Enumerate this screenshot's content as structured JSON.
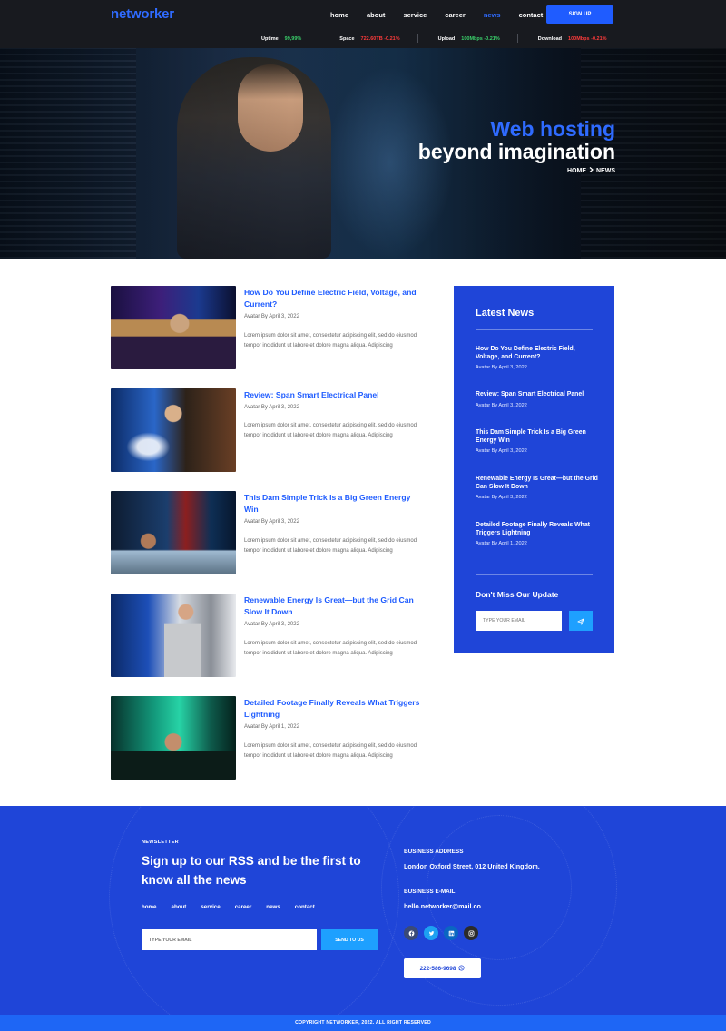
{
  "brand": {
    "logo": "networker"
  },
  "nav": {
    "items": [
      "home",
      "about",
      "service",
      "career",
      "news",
      "contact"
    ],
    "active": "news",
    "signup_label": "SIGN UP"
  },
  "stats": [
    {
      "label": "Uptime",
      "value": "99,99%",
      "trend": "up"
    },
    {
      "label": "Space",
      "value": "722.60TB -0.21%",
      "trend": "down"
    },
    {
      "label": "Upload",
      "value": "100Mbps -0.21%",
      "trend": "up"
    },
    {
      "label": "Download",
      "value": "100Mbps -0.21%",
      "trend": "down"
    }
  ],
  "hero": {
    "title_line1": "Web hosting",
    "title_line2": "beyond imagination",
    "breadcrumb_home": "HOME",
    "breadcrumb_current": "NEWS"
  },
  "posts": [
    {
      "title": "How Do You Define Electric Field, Voltage, and Current?",
      "meta": "Avatar By April 3, 2022",
      "excerpt": "Lorem ipsum dolor sit amet, consectetur adipiscing elit, sed do eiusmod tempor incididunt ut labore et dolore magna aliqua. Adipiscing"
    },
    {
      "title": "Review: Span Smart Electrical Panel",
      "meta": "Avatar By April 3, 2022",
      "excerpt": "Lorem ipsum dolor sit amet, consectetur adipiscing elit, sed do eiusmod tempor incididunt ut labore et dolore magna aliqua. Adipiscing"
    },
    {
      "title": "This Dam Simple Trick Is a Big Green Energy Win",
      "meta": "Avatar By April 3, 2022",
      "excerpt": "Lorem ipsum dolor sit amet, consectetur adipiscing elit, sed do eiusmod tempor incididunt ut labore et dolore magna aliqua. Adipiscing"
    },
    {
      "title": "Renewable Energy Is Great—but the Grid Can Slow It Down",
      "meta": "Avatar By April 3, 2022",
      "excerpt": "Lorem ipsum dolor sit amet, consectetur adipiscing elit, sed do eiusmod tempor incididunt ut labore et dolore magna aliqua. Adipiscing"
    },
    {
      "title": "Detailed Footage Finally Reveals What Triggers Lightning",
      "meta": "Avatar By April 1, 2022",
      "excerpt": "Lorem ipsum dolor sit amet, consectetur adipiscing elit, sed do eiusmod tempor incididunt ut labore et dolore magna aliqua. Adipiscing"
    }
  ],
  "sidebar": {
    "title": "Latest News",
    "items": [
      {
        "title": "How Do You Define Electric Field, Voltage, and Current?",
        "meta": "Avatar By April 3, 2022"
      },
      {
        "title": "Review: Span Smart Electrical Panel",
        "meta": "Avatar By April 3, 2022"
      },
      {
        "title": "This Dam Simple Trick Is a Big Green Energy Win",
        "meta": "Avatar By April 3, 2022"
      },
      {
        "title": "Renewable Energy Is Great—but the Grid Can Slow It Down",
        "meta": "Avatar By April 3, 2022"
      },
      {
        "title": "Detailed Footage Finally Reveals What Triggers Lightning",
        "meta": "Avatar By April 1, 2022"
      }
    ],
    "update_title": "Don't Miss Our Update",
    "email_placeholder": "TYPE YOUR EMAIL"
  },
  "footer": {
    "newsletter_label": "NEWSLETTER",
    "newsletter_title": "Sign up to our RSS and be the first to know all the news",
    "nav": [
      "home",
      "about",
      "service",
      "career",
      "news",
      "contact"
    ],
    "email_placeholder": "TYPE YOUR EMAIL",
    "send_label": "SEND TO US",
    "address_label": "BUSINESS ADDRESS",
    "address_value": "London Oxford Street, 012 United Kingdom.",
    "email_label": "BUSINESS E-MAIL",
    "email_value": "hello.networker@mail.co",
    "phone": "222-586-9698",
    "copyright": "COPYRIGHT NETWORKER, 2022. ALL RIGHT RESERVED"
  },
  "colors": {
    "brand_blue": "#1f5cff",
    "sidebar_blue": "#1f45d8",
    "up_green": "#3ad16b",
    "down_red": "#ff3b3b",
    "header_dark": "#181a1f"
  },
  "icons": {
    "send": "paper-plane-icon",
    "socials": [
      "facebook-icon",
      "twitter-icon",
      "linkedin-icon",
      "instagram-icon"
    ],
    "phone": "whatsapp-icon"
  }
}
